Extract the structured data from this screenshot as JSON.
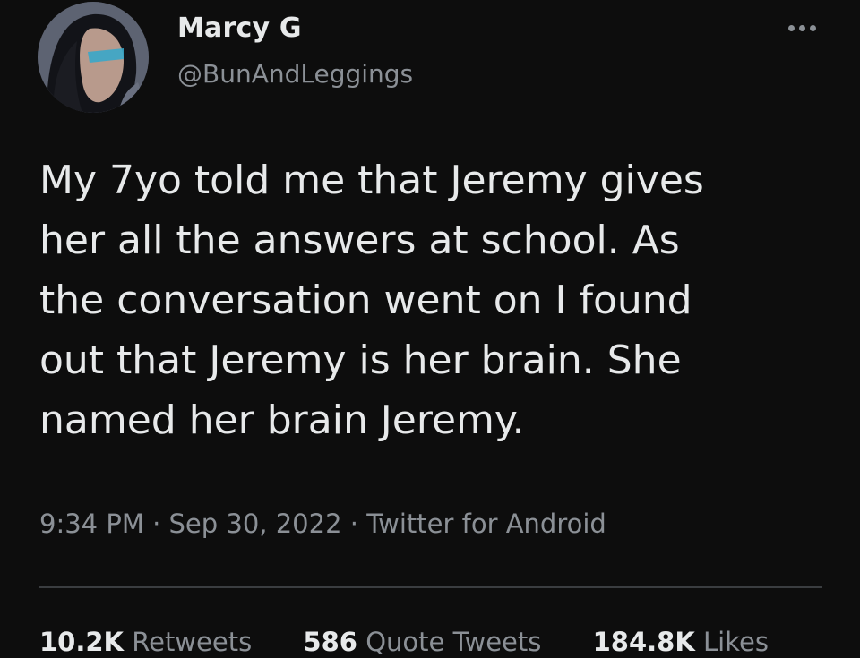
{
  "user": {
    "name": "Marcy G",
    "handle": "@BunAndLeggings"
  },
  "tweet": {
    "text": "My 7yo told me that Jeremy gives\nher all the answers at school. As\nthe conversation went on I found\nout that Jeremy is her brain. She\nnamed her brain Jeremy."
  },
  "meta": {
    "time": "9:34 PM",
    "separator": " · ",
    "date": "Sep 30, 2022",
    "source": "Twitter for Android"
  },
  "stats": {
    "retweets_count": "10.2K",
    "retweets_label": "Retweets",
    "quotes_count": "586",
    "quotes_label": "Quote Tweets",
    "likes_count": "184.8K",
    "likes_label": "Likes"
  },
  "icons": {
    "more": "more-options-icon"
  },
  "colors": {
    "background": "#0d0d0d",
    "text_primary": "#e7e9ea",
    "text_secondary": "#8b9096",
    "divider": "#3a3d40"
  }
}
